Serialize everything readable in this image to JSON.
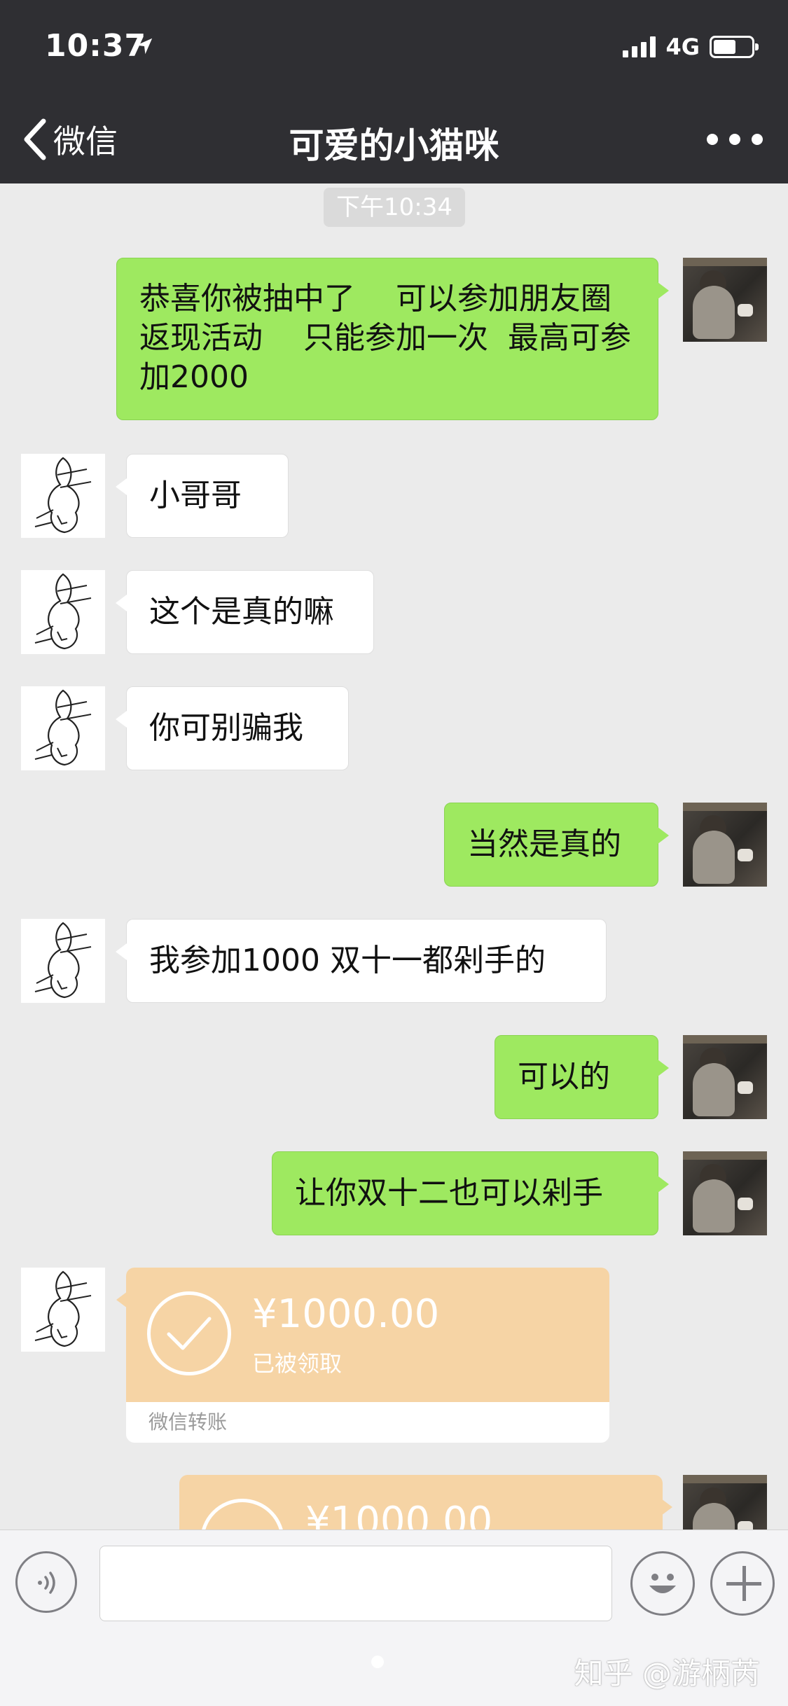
{
  "status_bar": {
    "time": "10:37",
    "network": "4G"
  },
  "nav": {
    "back_label": "微信",
    "title": "可爱的小猫咪"
  },
  "timestamp": "下午10:34",
  "messages": [
    {
      "side": "self",
      "text": "恭喜你被抽中了　 可以参加朋友圈返现活动　 只能参加一次  最高可参加2000"
    },
    {
      "side": "other",
      "text": "小哥哥"
    },
    {
      "side": "other",
      "text": "这个是真的嘛"
    },
    {
      "side": "other",
      "text": "你可别骗我"
    },
    {
      "side": "self",
      "text": "当然是真的"
    },
    {
      "side": "other",
      "text": "我参加1000  双十一都剁手的"
    },
    {
      "side": "self",
      "text": "可以的"
    },
    {
      "side": "self",
      "text": "让你双十二也可以剁手"
    }
  ],
  "transfer_other": {
    "amount": "¥1000.00",
    "status": "已被领取",
    "label": "微信转账"
  },
  "transfer_self": {
    "amount": "¥1000.00"
  },
  "input": {
    "value": "",
    "placeholder": ""
  },
  "watermark": "知乎 @游柄芮",
  "colors": {
    "nav_bg": "#2f2f33",
    "chat_bg": "#ebebeb",
    "self_bubble": "#9ee960",
    "transfer": "#f6d4a5"
  }
}
